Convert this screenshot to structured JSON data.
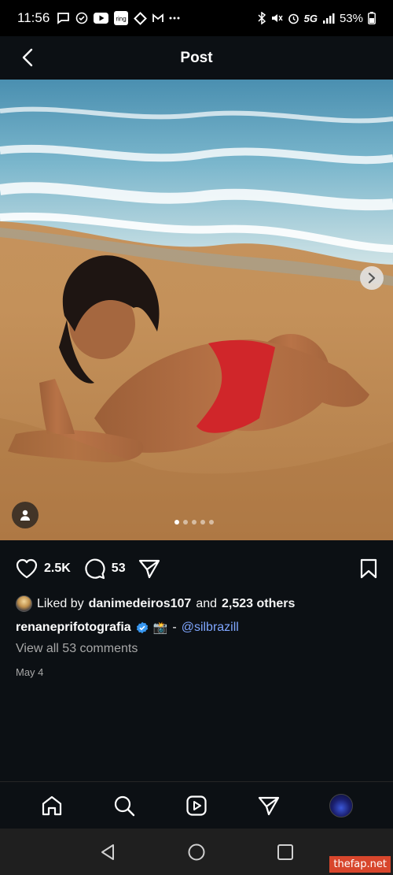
{
  "status_bar": {
    "time": "11:56",
    "app_icons": [
      "message-icon",
      "check-circle-icon",
      "youtube-icon",
      "ring-icon",
      "diamond-icon",
      "gmail-icon",
      "more-icon"
    ],
    "ring_label": "ring",
    "network": "5G",
    "battery": "53%"
  },
  "header": {
    "title": "Post"
  },
  "post": {
    "carousel": {
      "count": 5,
      "active_index": 0
    },
    "likes_count": "2.5K",
    "comments_count": "53",
    "liked_by_prefix": "Liked by",
    "liked_by_user": "danimedeiros107",
    "liked_by_and": "and",
    "liked_by_others": "2,523 others",
    "author": "renaneprifotografia",
    "caption_emoji": "📸",
    "caption_separator": "-",
    "caption_mention": "@silbrazill",
    "view_comments": "View all 53 comments",
    "date": "May 4"
  },
  "bottom_nav": {
    "items": [
      "home-icon",
      "search-icon",
      "reels-icon",
      "send-icon",
      "profile-avatar"
    ]
  },
  "watermark": "thefap.net",
  "colors": {
    "background": "#0c1014",
    "mention": "#7fa6ff",
    "verified": "#3897f0"
  }
}
